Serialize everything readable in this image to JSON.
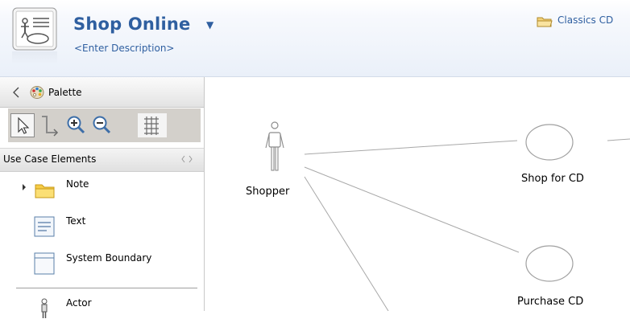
{
  "header": {
    "title": "Shop Online",
    "description": "<Enter Description>",
    "breadcrumb": "Classics CD",
    "icon": "use-case-diagram-icon"
  },
  "palette": {
    "label": "Palette",
    "tools": [
      "select-tool",
      "connection-tool",
      "zoom-in-tool",
      "zoom-out-tool",
      "grid-tool"
    ],
    "drawer_label": "Use Case Elements",
    "items": [
      {
        "label": "Note",
        "icon": "note-icon"
      },
      {
        "label": "Text",
        "icon": "text-icon"
      },
      {
        "label": "System Boundary",
        "icon": "system-boundary-icon"
      },
      {
        "label": "Actor",
        "icon": "actor-icon"
      }
    ]
  },
  "diagram": {
    "actor": {
      "label": "Shopper"
    },
    "use_cases": [
      {
        "label": "Shop for CD"
      },
      {
        "label": "Purchase CD"
      }
    ]
  },
  "colors": {
    "title": "#2f5fa0",
    "toolbar": "#d3d0cb",
    "association_line": "#a8a8a8"
  }
}
